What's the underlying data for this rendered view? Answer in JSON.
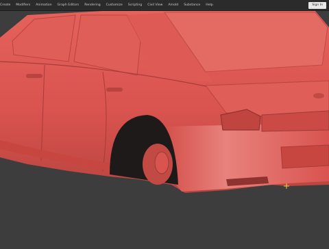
{
  "menubar": {
    "items": [
      "Create",
      "Modifiers",
      "Animation",
      "Graph Editors",
      "Rendering",
      "Customize",
      "Scripting",
      "Civil View",
      "Arnold",
      "Substance",
      "Help"
    ],
    "signin_label": "Sign In"
  },
  "viewport": {
    "background_color": "#3d3d3d",
    "model_color": "#d9534f",
    "model_shadow_color": "#9c3a37"
  }
}
